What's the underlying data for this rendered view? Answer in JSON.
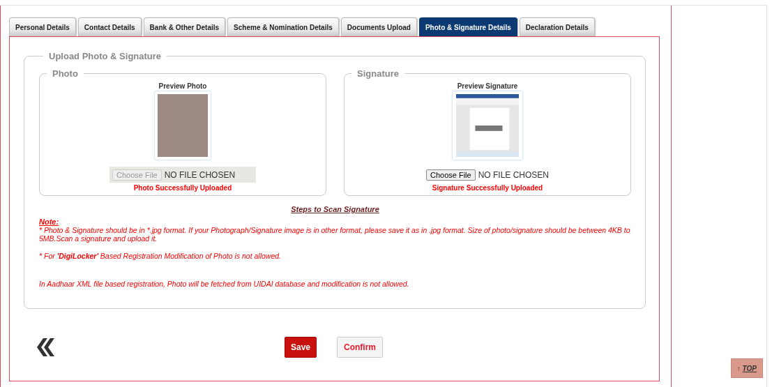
{
  "tabs": [
    {
      "label": "Personal Details",
      "selected": false
    },
    {
      "label": "Contact Details",
      "selected": false
    },
    {
      "label": "Bank & Other Details",
      "selected": false
    },
    {
      "label": "Scheme & Nomination Details",
      "selected": false
    },
    {
      "label": "Documents Upload",
      "selected": false
    },
    {
      "label": "Photo & Signature Details",
      "selected": true
    },
    {
      "label": "Declaration Details",
      "selected": false
    }
  ],
  "upload_section": {
    "title": "Upload Photo & Signature",
    "panels": [
      {
        "kind": "photo",
        "title": "Photo",
        "preview_label": "Preview Photo",
        "file_button": "Choose File",
        "file_status": "NO FILE CHOSEN",
        "disabled": true,
        "message": "Photo Successfully Uploaded"
      },
      {
        "kind": "signature",
        "title": "Signature",
        "preview_label": "Preview Signature",
        "file_button": "Choose File",
        "file_status": "NO FILE CHOSEN",
        "disabled": false,
        "message": "Signature Successfully Uploaded"
      }
    ],
    "scan_link": "Steps to Scan Signature",
    "note": {
      "heading": "Note:",
      "lines": [
        "* Photo & Signature should be in *.jpg format. If your Photograph/Signature image is in other format, please save it as in .jpg format. Size of photo/signature should be between 4KB to 5MB.Scan a signature and upload it.",
        "* For **'DigiLocker'** Based Registration Modification of Photo is not allowed.",
        "In Aadhaar XML file based registration, Photo will be fetched from UIDAI database and modification is not allowed."
      ]
    }
  },
  "actions": [
    {
      "kind": "primary",
      "label": "Save"
    },
    {
      "kind": "secondary",
      "label": "Confirm"
    }
  ],
  "top_button": {
    "arrow": "↑",
    "label": "TOP"
  }
}
